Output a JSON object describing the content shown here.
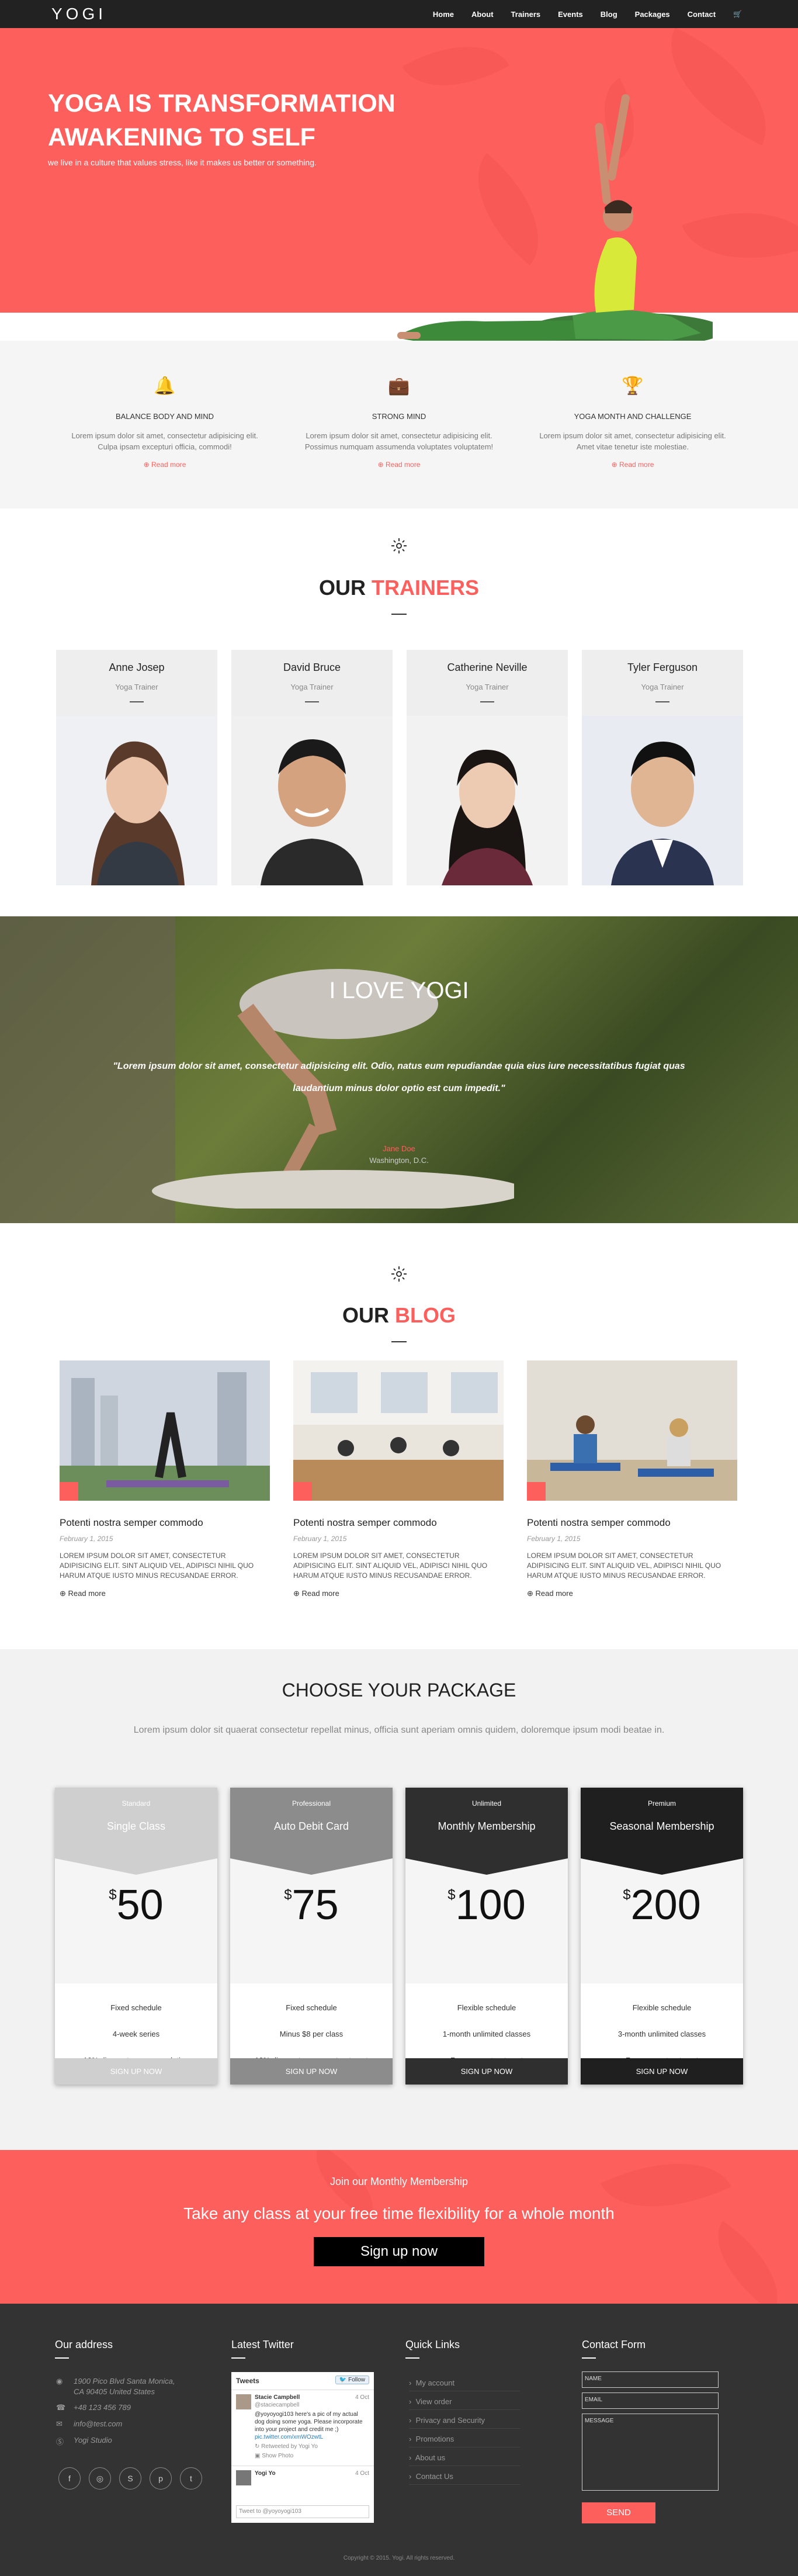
{
  "brand": {
    "logo": "YOGI",
    "accent": "#fd5f5d"
  },
  "nav": {
    "items": [
      "Home",
      "About",
      "Trainers",
      "Events",
      "Blog",
      "Packages",
      "Contact"
    ],
    "cart_icon": "cart-icon"
  },
  "hero": {
    "title_line1": "YOGA IS TRANSFORMATION",
    "title_line2": "AWAKENING TO SELF",
    "subtitle": "we live in a culture that values stress, like it makes us better or something."
  },
  "features": [
    {
      "icon": "bell-icon",
      "title": "BALANCE BODY AND MIND",
      "text_line1": "Lorem ipsum dolor sit amet, consectetur adipisicing elit.",
      "text_line2": "Culpa ipsam excepturi officia, commodi!",
      "link": "Read more"
    },
    {
      "icon": "briefcase-icon",
      "title": "STRONG MIND",
      "text_line1": "Lorem ipsum dolor sit amet, consectetur adipisicing elit.",
      "text_line2": "Possimus numquam assumenda voluptates voluptatem!",
      "link": "Read more"
    },
    {
      "icon": "trophy-icon",
      "title": "YOGA MONTH AND CHALLENGE",
      "text_line1": "Lorem ipsum dolor sit amet, consectetur adipisicing elit.",
      "text_line2": "Amet vitae tenetur iste molestiae.",
      "link": "Read more"
    }
  ],
  "trainers": {
    "title_a": "OUR ",
    "title_b": "TRAINERS",
    "items": [
      {
        "name": "Anne Josep",
        "role": "Yoga Trainer"
      },
      {
        "name": "David Bruce",
        "role": "Yoga Trainer"
      },
      {
        "name": "Catherine Neville",
        "role": "Yoga Trainer"
      },
      {
        "name": "Tyler Ferguson",
        "role": "Yoga Trainer"
      }
    ]
  },
  "testimonial": {
    "heading": "I LOVE YOGI",
    "quote_line1": "\"Lorem ipsum dolor sit amet, consectetur adipisicing elit. Odio, natus eum repudiandae quia eius iure necessitatibus fugiat quas",
    "quote_line2": "laudantium minus dolor optio est cum impedit.\"",
    "author": "Jane Doe",
    "location": "Washington, D.C."
  },
  "blog": {
    "title_a": "OUR ",
    "title_b": "BLOG",
    "posts": [
      {
        "title": "Potenti nostra semper commodo",
        "date": "February 1, 2015",
        "excerpt_line1": "LOREM IPSUM DOLOR SIT AMET, CONSECTETUR",
        "excerpt_line2": "ADIPISICING ELIT. SINT ALIQUID VEL, ADIPISCI NIHIL QUO",
        "excerpt_line3": "HARUM ATQUE IUSTO MINUS RECUSANDAE ERROR.",
        "more": "Read more"
      },
      {
        "title": "Potenti nostra semper commodo",
        "date": "February 1, 2015",
        "excerpt_line1": "LOREM IPSUM DOLOR SIT AMET, CONSECTETUR",
        "excerpt_line2": "ADIPISICING ELIT. SINT ALIQUID VEL, ADIPISCI NIHIL QUO",
        "excerpt_line3": "HARUM ATQUE IUSTO MINUS RECUSANDAE ERROR.",
        "more": "Read more"
      },
      {
        "title": "Potenti nostra semper commodo",
        "date": "February 1, 2015",
        "excerpt_line1": "LOREM IPSUM DOLOR SIT AMET, CONSECTETUR",
        "excerpt_line2": "ADIPISICING ELIT. SINT ALIQUID VEL, ADIPISCI NIHIL QUO",
        "excerpt_line3": "HARUM ATQUE IUSTO MINUS RECUSANDAE ERROR.",
        "more": "Read more"
      }
    ]
  },
  "pricing": {
    "title": "CHOOSE YOUR PACKAGE",
    "subtitle": "Lorem ipsum dolor sit quaerat consectetur repellat minus, officia sunt aperiam omnis quidem, doloremque ipsum modi beatae in.",
    "plans": [
      {
        "tier": "Standard",
        "name": "Single Class",
        "currency": "$",
        "price": "50",
        "f1": "Fixed schedule",
        "f2": "4-week series",
        "f3": "10% discount on accomodation",
        "button": "SIGN UP NOW",
        "color": "#cfcfcf"
      },
      {
        "tier": "Professional",
        "name": "Auto Debit Card",
        "currency": "$",
        "price": "75",
        "f1": "Fixed schedule",
        "f2": "Minus $8 per class",
        "f3": "10% discount on sauna treatment",
        "button": "SIGN UP NOW",
        "color": "#8c8c8c"
      },
      {
        "tier": "Unlimited",
        "name": "Monthly Membership",
        "currency": "$",
        "price": "100",
        "f1": "Flexible schedule",
        "f2": "1-month unlimited classes",
        "f3": "Free sauna treatment",
        "button": "SIGN UP NOW",
        "color": "#2f2f2f"
      },
      {
        "tier": "Premium",
        "name": "Seasonal Membership",
        "currency": "$",
        "price": "200",
        "f1": "Flexible schedule",
        "f2": "3-month unlimited classes",
        "f3": "Free sauna treatment",
        "button": "SIGN UP NOW",
        "color": "#1f1f1f"
      }
    ]
  },
  "cta": {
    "small": "Join our Monthly Membership",
    "big": "Take any class at your free time flexibility for a whole month",
    "button": "Sign up now"
  },
  "footer": {
    "address_title": "Our address",
    "addr_line1": "1900 Pico Blvd Santa Monica,",
    "addr_line2": "CA 90405 United States",
    "phone": "+48 123 456 789",
    "email": "info@test.com",
    "skype": "Yogi Studio",
    "twitter_title": "Latest Twitter",
    "tweets_label": "Tweets",
    "follow": "Follow",
    "tweet_author": "Stacie Campbell",
    "tweet_handle": "@staciecampbell",
    "tweet_date": "4 Oct",
    "tweet_text_1": "@yoyoyogi103 here's a pic of my actual",
    "tweet_text_2": "dog doing some yoga. Please incorporate",
    "tweet_text_3": "into your project and credit me ;)",
    "tweet_link": "pic.twitter.com/xmWOzwtL",
    "retweeted": "Retweeted by Yogi Yo",
    "show_photo": "Show Photo",
    "tweet2_author": "Yogi Yo",
    "tweet2_date": "4 Oct",
    "tweet_to": "Tweet to @yoyoyogi103",
    "links_title": "Quick Links",
    "links": [
      "My account",
      "View order",
      "Privacy and Security",
      "Promotions",
      "About us",
      "Contact Us"
    ],
    "contact_title": "Contact Form",
    "name_ph": "NAME",
    "email_ph": "EMAIL",
    "message_ph": "MESSAGE",
    "send": "SEND",
    "copyright": "Copyright © 2015. Yogi. All rights reserved."
  }
}
